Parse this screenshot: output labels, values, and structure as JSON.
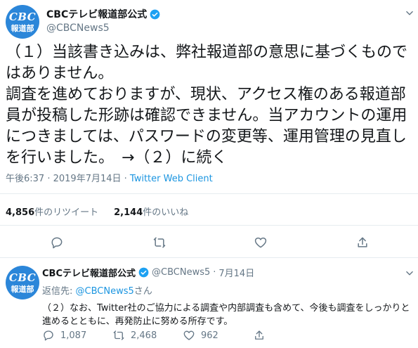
{
  "tweet": {
    "avatar": {
      "logo": "CBC",
      "sub": "報道部"
    },
    "display_name": "CBCテレビ報道部公式",
    "handle": "@CBCNews5",
    "text": "（１）当該書き込みは、弊社報道部の意思に基づくものではありません。\n調査を進めておりますが、現状、アクセス権のある報道部員が投稿した形跡は確認できません。当アカウントの運用につきましては、パスワードの変更等、運用管理の見直しを行いました。　→（２）に続く",
    "time": "午後6:37",
    "date": "2019年7月14日",
    "sep": " · ",
    "client": "Twitter Web Client",
    "retweets": {
      "count": "4,856",
      "label": "件のリツイート"
    },
    "likes": {
      "count": "2,144",
      "label": "件のいいね"
    }
  },
  "reply": {
    "display_name": "CBCテレビ報道部公式",
    "handle": "@CBCNews5",
    "sep": "·",
    "date": "7月14日",
    "reply_to_label": "返信先:",
    "reply_to_handle": "@CBCNews5",
    "reply_to_suffix": "さん",
    "text": "（２）なお、Twitter社のご協力による調査や内部調査も含めて、今後も調査をしっかりと進めるとともに、再発防止に努める所存です。",
    "reply_count": "1,087",
    "retweet_count": "2,468",
    "like_count": "962"
  },
  "colors": {
    "accent": "#1b95e0",
    "avatar": "#2b86d9",
    "muted": "#657786"
  }
}
